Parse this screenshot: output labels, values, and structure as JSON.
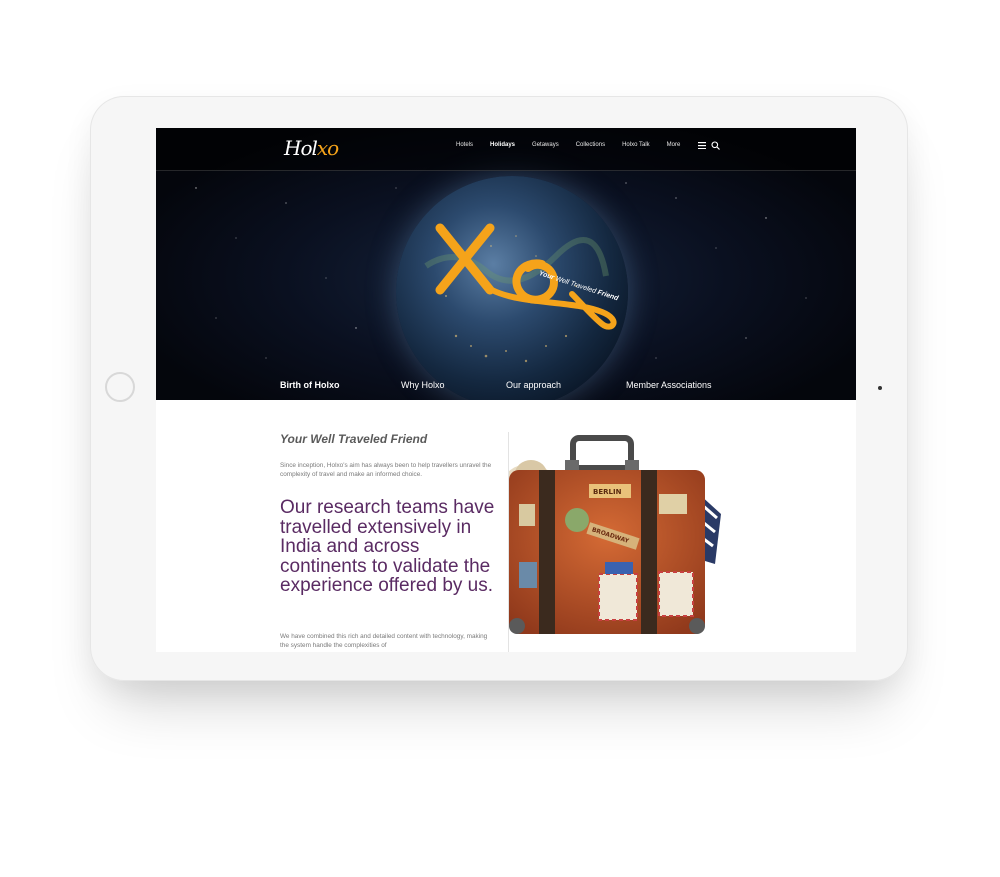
{
  "nav": {
    "logo_text": "Hol",
    "logo_accent": "xo",
    "items": [
      {
        "label": "Hotels",
        "active": false
      },
      {
        "label": "Holidays",
        "active": true
      },
      {
        "label": "Getaways",
        "active": false
      },
      {
        "label": "Collections",
        "active": false
      },
      {
        "label": "Holxo Talk",
        "active": false
      },
      {
        "label": "More",
        "active": false
      }
    ],
    "menu_icon": "hamburger-icon",
    "search_icon": "search-icon"
  },
  "hero": {
    "tagline_bold": "Your",
    "tagline_mid": "Well Traveled",
    "tagline_end": "Friend",
    "tabs": [
      {
        "label": "Birth of Holxo",
        "active": true
      },
      {
        "label": "Why Holxo",
        "active": false
      },
      {
        "label": "Our  approach",
        "active": false
      },
      {
        "label": "Member Associations",
        "active": false
      }
    ]
  },
  "content": {
    "title": "Your Well Traveled Friend",
    "intro": "Since inception, Holxo's aim has always been to help travellers unravel the complexity of travel and make an informed choice.",
    "headline": "Our research teams have travelled extensively in India and across continents to validate the experience offered by us.",
    "body": "We have combined this rich and detailed content with technology, making the system handle the complexities of",
    "suitcase_labels": [
      "BERLIN",
      "BROADWAY"
    ]
  },
  "colors": {
    "accent": "#f5a31a",
    "headline": "#5a2b63",
    "hero_bg": "#04060c"
  }
}
